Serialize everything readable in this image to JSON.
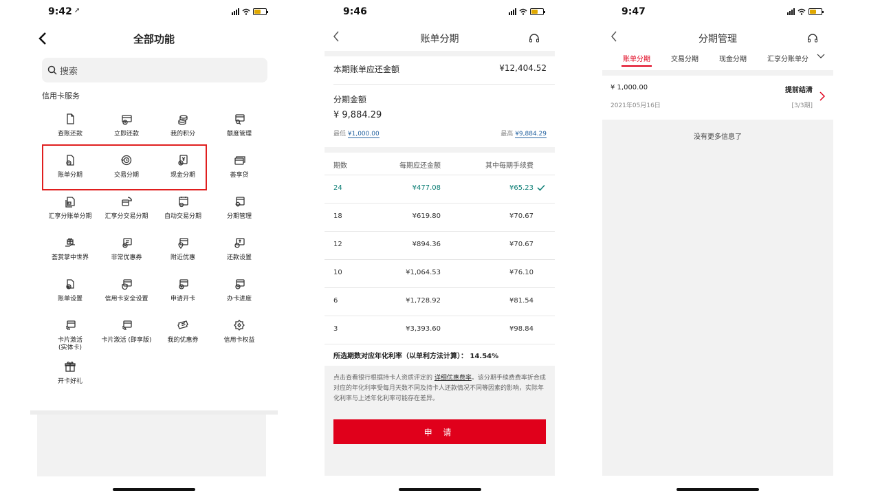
{
  "screen1": {
    "status_time": "9:42",
    "title": "全部功能",
    "search_placeholder": "搜索",
    "section": "信用卡服务",
    "tiles": [
      {
        "label": "查账还款",
        "icon": "document-icon"
      },
      {
        "label": "立即还款",
        "icon": "card-upload-icon"
      },
      {
        "label": "我的积分",
        "icon": "coins-icon"
      },
      {
        "label": "额度管理",
        "icon": "card-search-icon"
      },
      {
        "label": "账单分期",
        "icon": "bill-clock-icon"
      },
      {
        "label": "交易分期",
        "icon": "cycle-clock-icon"
      },
      {
        "label": "现金分期",
        "icon": "cash-clock-icon"
      },
      {
        "label": "荟享贷",
        "icon": "card-stack-icon"
      },
      {
        "label": "汇享分账单分期",
        "icon": "doc-stack-icon"
      },
      {
        "label": "汇享分交易分期",
        "icon": "refresh-card-icon"
      },
      {
        "label": "自动交易分期",
        "icon": "calendar-gear-icon"
      },
      {
        "label": "分期管理",
        "icon": "doc-gear-icon"
      },
      {
        "label": "荟赏掌中世界",
        "icon": "gift-hand-icon"
      },
      {
        "label": "非常优惠券",
        "icon": "coupon-plus-icon"
      },
      {
        "label": "附近优惠",
        "icon": "location-card-icon"
      },
      {
        "label": "还款设置",
        "icon": "gear-card-icon"
      },
      {
        "label": "账单设置",
        "icon": "bill-gear-icon"
      },
      {
        "label": "信用卡安全设置",
        "icon": "shield-card-icon"
      },
      {
        "label": "申请开卡",
        "icon": "card-add-icon"
      },
      {
        "label": "办卡进度",
        "icon": "card-progress-icon"
      },
      {
        "label": "卡片激活\n(实体卡)",
        "icon": "card-nfc-icon"
      },
      {
        "label": "卡片激活 (即享版)",
        "icon": "card-nfc-icon"
      },
      {
        "label": "我的优惠券",
        "icon": "ticket-icon"
      },
      {
        "label": "信用卡权益",
        "icon": "badge-icon"
      },
      {
        "label": "开卡好礼",
        "icon": "gift-icon"
      }
    ]
  },
  "screen2": {
    "status_time": "9:46",
    "title": "账单分期",
    "bill_label": "本期账单应还金额",
    "bill_amount": "¥12,404.52",
    "installment_label": "分期金额",
    "installment_value": "¥ 9,884.29",
    "min_label": "最低",
    "min_value": "¥1,000.00",
    "max_label": "最高",
    "max_value": "¥9,884.29",
    "table_headers": [
      "期数",
      "每期应还金额",
      "其中每期手续费"
    ],
    "rows": [
      {
        "periods": "24",
        "payment": "¥477.08",
        "fee": "¥65.23",
        "selected": true
      },
      {
        "periods": "18",
        "payment": "¥619.80",
        "fee": "¥70.67",
        "selected": false
      },
      {
        "periods": "12",
        "payment": "¥894.36",
        "fee": "¥70.67",
        "selected": false
      },
      {
        "periods": "10",
        "payment": "¥1,064.53",
        "fee": "¥76.10",
        "selected": false
      },
      {
        "periods": "6",
        "payment": "¥1,728.92",
        "fee": "¥81.54",
        "selected": false
      },
      {
        "periods": "3",
        "payment": "¥3,393.60",
        "fee": "¥98.84",
        "selected": false
      }
    ],
    "rate_text": "所选期数对应年化利率（以单利方法计算）： 14.54%",
    "note_prefix": "点击查看银行根据持卡人资质评定的 ",
    "note_link": "详细优惠费率",
    "note_suffix": "。该分期手续费费率折合成对应的年化利率受每月天数不同及持卡人还款情况不同等因素的影响，实际年化利率与上述年化利率可能存在差异。",
    "apply_label": "申 请"
  },
  "screen3": {
    "status_time": "9:47",
    "title": "分期管理",
    "tabs": [
      "账单分期",
      "交易分期",
      "现金分期",
      "汇享分账单分"
    ],
    "active_tab": 0,
    "record": {
      "amount": "¥ 1,000.00",
      "action": "提前结清",
      "date": "2021年05月16日",
      "term": "[3/3期]"
    },
    "no_more": "没有更多信息了"
  },
  "colors": {
    "accent_red": "#e0001b",
    "selected_teal": "#0a7d74",
    "link_blue": "#1f5f9e",
    "highlight_box": "#e01e1e"
  }
}
